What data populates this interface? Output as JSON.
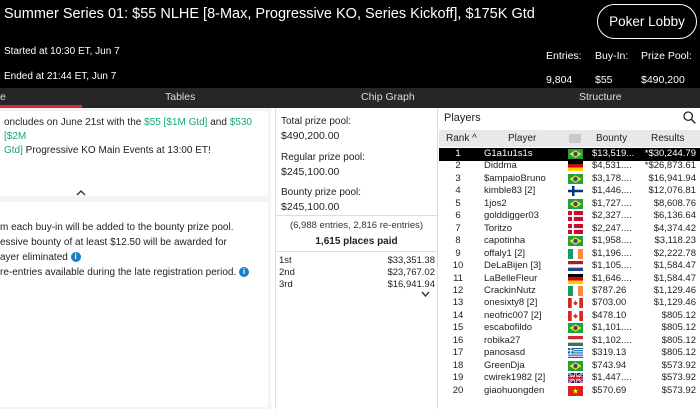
{
  "header": {
    "title": "Summer Series 01: $55 NLHE [8-Max, Progressive KO, Series Kickoff], $175K Gtd",
    "lobby_button": "Poker Lobby",
    "started": "Started at 10:30 ET, Jun 7",
    "ended": "Ended at 21:44 ET, Jun 7",
    "stats": [
      {
        "label": "Entries:",
        "value": "9,804"
      },
      {
        "label": "Buy-In:",
        "value": "$55"
      },
      {
        "label": "Prize Pool:",
        "value": "$490,200"
      }
    ]
  },
  "tabs": [
    "e",
    "Tables",
    "Chip Graph",
    "Structure"
  ],
  "colors": {
    "accent": "#e0243a",
    "link_green": "#14a87a",
    "header_bg": "#000000"
  },
  "info_card": {
    "line1_prefix": "oncludes on June 21st with the ",
    "link1": "$55 [$1M Gtd]",
    "and": " and ",
    "link2": "$530 [$2M",
    "line2_link": "Gtd]",
    "line2_rest": " Progressive KO Main Events at 13:00 ET!"
  },
  "bounty_card": {
    "line1": "m each buy-in will be added to the bounty prize pool.",
    "line2": "essive bounty of at least $12.50 will be awarded for",
    "line3": "ayer eliminated",
    "line4": "re-entries available during the late registration period."
  },
  "prize": {
    "total_label": "Total prize pool:",
    "total_value": "$490,200.00",
    "regular_label": "Regular prize pool:",
    "regular_value": "$245,100.00",
    "bounty_label": "Bounty prize pool:",
    "bounty_value": "$245,100.00",
    "entries_note": "(6,988 entries, 2,816 re-entries)",
    "places_paid": "1,615 places paid"
  },
  "payouts": [
    {
      "place": "1st",
      "amount": "$33,351.38"
    },
    {
      "place": "2nd",
      "amount": "$23,767.02"
    },
    {
      "place": "3rd",
      "amount": "$16,941.94"
    }
  ],
  "players": {
    "title": "Players",
    "columns": [
      "Rank",
      "Player",
      "Bounty",
      "Results"
    ],
    "rows": [
      {
        "rank": "1",
        "name": "G1a1u1s1s",
        "flag": "br",
        "bounty": "$13,519...",
        "result": "*$30,244.79"
      },
      {
        "rank": "2",
        "name": "Diddma",
        "flag": "de",
        "bounty": "$4,531....",
        "result": "*$26,873.61"
      },
      {
        "rank": "3",
        "name": "$ampaioBruno",
        "flag": "br",
        "bounty": "$3,178....",
        "result": "$16,941.94"
      },
      {
        "rank": "4",
        "name": "kimble83 [2]",
        "flag": "fi",
        "bounty": "$1,446....",
        "result": "$12,076.81"
      },
      {
        "rank": "5",
        "name": "1jos2",
        "flag": "br",
        "bounty": "$1,727....",
        "result": "$8,608.76"
      },
      {
        "rank": "6",
        "name": "golddigger03",
        "flag": "dk",
        "bounty": "$2,327....",
        "result": "$6,136.64"
      },
      {
        "rank": "7",
        "name": "Toritzo",
        "flag": "dk",
        "bounty": "$2,247....",
        "result": "$4,374.42"
      },
      {
        "rank": "8",
        "name": "capotinha",
        "flag": "br",
        "bounty": "$1,958....",
        "result": "$3,118.23"
      },
      {
        "rank": "9",
        "name": "offaly1 [2]",
        "flag": "ie",
        "bounty": "$1,196....",
        "result": "$2,222.78"
      },
      {
        "rank": "10",
        "name": "DeLaBijen [3]",
        "flag": "nl",
        "bounty": "$1,105....",
        "result": "$1,584.47"
      },
      {
        "rank": "11",
        "name": "LaBelleFleur",
        "flag": "de",
        "bounty": "$1,646....",
        "result": "$1,584.47"
      },
      {
        "rank": "12",
        "name": "CrackinNutz",
        "flag": "ie",
        "bounty": "$787.26",
        "result": "$1,129.46"
      },
      {
        "rank": "13",
        "name": "onesixty8 [2]",
        "flag": "ca",
        "bounty": "$703.00",
        "result": "$1,129.46"
      },
      {
        "rank": "14",
        "name": "neofric007 [2]",
        "flag": "ca",
        "bounty": "$478.10",
        "result": "$805.12"
      },
      {
        "rank": "15",
        "name": "escabofildo",
        "flag": "br",
        "bounty": "$1,101....",
        "result": "$805.12"
      },
      {
        "rank": "16",
        "name": "robika27",
        "flag": "hu",
        "bounty": "$1,102....",
        "result": "$805.12"
      },
      {
        "rank": "17",
        "name": "panosasd",
        "flag": "gr",
        "bounty": "$319.13",
        "result": "$805.12"
      },
      {
        "rank": "18",
        "name": "GreenDja",
        "flag": "br",
        "bounty": "$743.94",
        "result": "$573.92"
      },
      {
        "rank": "19",
        "name": "cwirek1982 [2]",
        "flag": "gb",
        "bounty": "$1,447....",
        "result": "$573.92"
      },
      {
        "rank": "20",
        "name": "giaohuongden",
        "flag": "vn",
        "bounty": "$570.69",
        "result": "$573.92"
      }
    ]
  }
}
